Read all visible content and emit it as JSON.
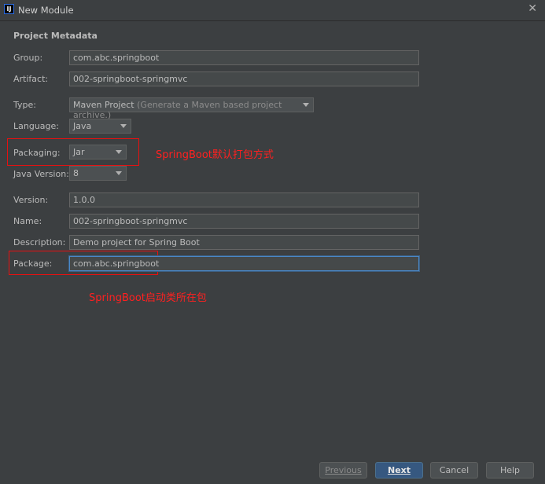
{
  "window": {
    "title": "New Module",
    "app_icon": "IJ"
  },
  "section": {
    "title": "Project Metadata"
  },
  "form": {
    "group": {
      "label": "Group:",
      "value": "com.abc.springboot"
    },
    "artifact": {
      "label": "Artifact:",
      "value": "002-springboot-springmvc"
    },
    "type": {
      "label": "Type:",
      "value": "Maven Project",
      "hint": "(Generate a Maven based project archive.)"
    },
    "language": {
      "label": "Language:",
      "value": "Java"
    },
    "packaging": {
      "label": "Packaging:",
      "value": "Jar"
    },
    "java_version": {
      "label": "Java Version:",
      "value": "8"
    },
    "version": {
      "label": "Version:",
      "value": "1.0.0"
    },
    "name": {
      "label": "Name:",
      "value": "002-springboot-springmvc"
    },
    "description": {
      "label": "Description:",
      "value": "Demo project for Spring Boot"
    },
    "package": {
      "label": "Package:",
      "value": "com.abc.springboot"
    }
  },
  "annotations": {
    "packaging_note": "SpringBoot默认打包方式",
    "package_note": "SpringBoot启动类所在包"
  },
  "buttons": {
    "previous": "Previous",
    "next": "Next",
    "cancel": "Cancel",
    "help": "Help"
  },
  "colors": {
    "background": "#3c3f41",
    "annotation": "#e81010",
    "primary_button": "#365880",
    "focus_border": "#4a88c7"
  }
}
